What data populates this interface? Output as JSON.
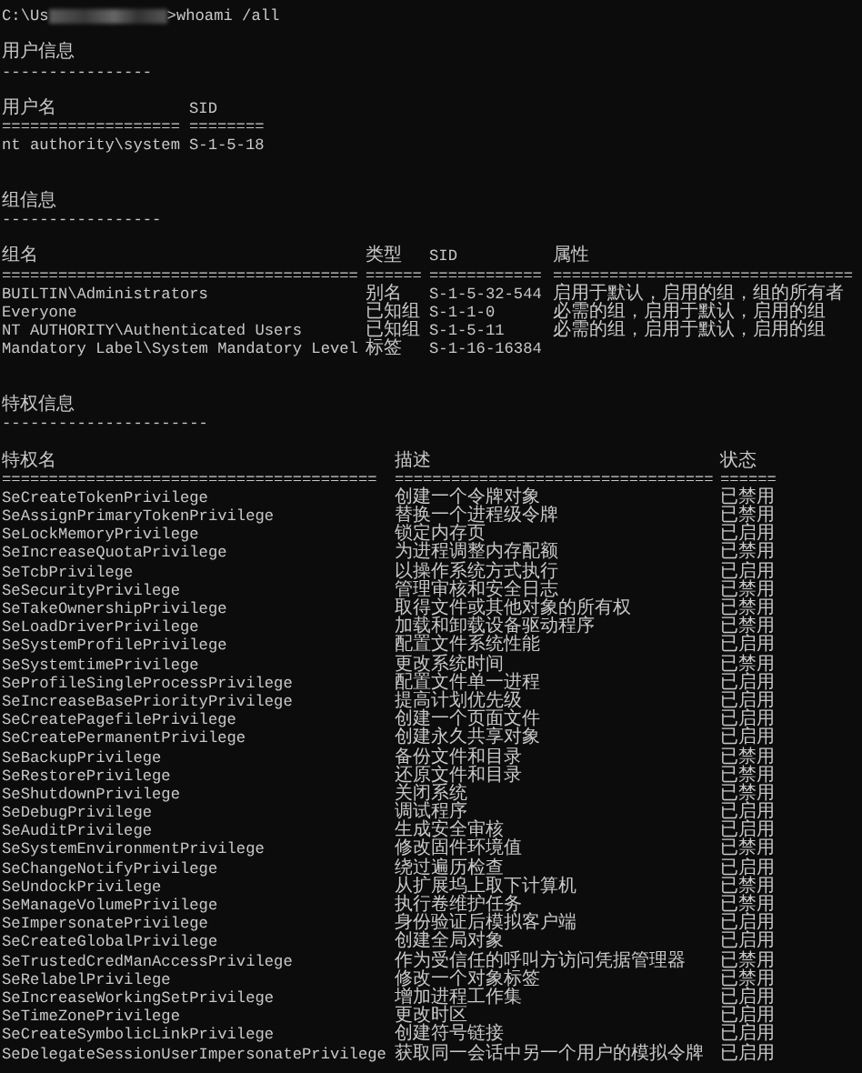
{
  "prompt": {
    "path_start": "C:\\Us",
    "command": ">whoami /all"
  },
  "user_info": {
    "heading": "用户信息",
    "underline": "----------------",
    "columns": [
      "用户名",
      "SID"
    ],
    "rules": [
      "===================",
      "========"
    ],
    "rows": [
      {
        "name": "nt authority\\system",
        "sid": "S-1-5-18"
      }
    ]
  },
  "group_info": {
    "heading": "组信息",
    "underline": "-----------------",
    "columns": [
      "组名",
      "类型",
      "SID",
      "属性"
    ],
    "rules": [
      "======================================",
      "======",
      "============",
      "================================"
    ],
    "rows": [
      {
        "name": "BUILTIN\\Administrators",
        "type": "别名",
        "sid": "S-1-5-32-544",
        "attributes": "启用于默认，启用的组，组的所有者"
      },
      {
        "name": "Everyone",
        "type": "已知组",
        "sid": "S-1-1-0",
        "attributes": "必需的组，启用于默认，启用的组"
      },
      {
        "name": "NT AUTHORITY\\Authenticated Users",
        "type": "已知组",
        "sid": "S-1-5-11",
        "attributes": "必需的组，启用于默认，启用的组"
      },
      {
        "name": "Mandatory Label\\System Mandatory Level",
        "type": "标签",
        "sid": "S-1-16-16384"
      }
    ]
  },
  "privileges": {
    "heading": "特权信息",
    "underline": "----------------------",
    "columns": [
      "特权名",
      "描述",
      "状态"
    ],
    "rules": [
      "========================================",
      "==================================",
      "======"
    ],
    "rows": [
      {
        "name": "SeCreateTokenPrivilege",
        "description": "创建一个令牌对象",
        "state": "已禁用"
      },
      {
        "name": "SeAssignPrimaryTokenPrivilege",
        "description": "替换一个进程级令牌",
        "state": "已禁用"
      },
      {
        "name": "SeLockMemoryPrivilege",
        "description": "锁定内存页",
        "state": "已启用"
      },
      {
        "name": "SeIncreaseQuotaPrivilege",
        "description": "为进程调整内存配额",
        "state": "已禁用"
      },
      {
        "name": "SeTcbPrivilege",
        "description": "以操作系统方式执行",
        "state": "已启用"
      },
      {
        "name": "SeSecurityPrivilege",
        "description": "管理审核和安全日志",
        "state": "已禁用"
      },
      {
        "name": "SeTakeOwnershipPrivilege",
        "description": "取得文件或其他对象的所有权",
        "state": "已禁用"
      },
      {
        "name": "SeLoadDriverPrivilege",
        "description": "加载和卸载设备驱动程序",
        "state": "已禁用"
      },
      {
        "name": "SeSystemProfilePrivilege",
        "description": "配置文件系统性能",
        "state": "已启用"
      },
      {
        "name": "SeSystemtimePrivilege",
        "description": "更改系统时间",
        "state": "已禁用"
      },
      {
        "name": "SeProfileSingleProcessPrivilege",
        "description": "配置文件单一进程",
        "state": "已启用"
      },
      {
        "name": "SeIncreaseBasePriorityPrivilege",
        "description": "提高计划优先级",
        "state": "已启用"
      },
      {
        "name": "SeCreatePagefilePrivilege",
        "description": "创建一个页面文件",
        "state": "已启用"
      },
      {
        "name": "SeCreatePermanentPrivilege",
        "description": "创建永久共享对象",
        "state": "已启用"
      },
      {
        "name": "SeBackupPrivilege",
        "description": "备份文件和目录",
        "state": "已禁用"
      },
      {
        "name": "SeRestorePrivilege",
        "description": "还原文件和目录",
        "state": "已禁用"
      },
      {
        "name": "SeShutdownPrivilege",
        "description": "关闭系统",
        "state": "已禁用"
      },
      {
        "name": "SeDebugPrivilege",
        "description": "调试程序",
        "state": "已启用"
      },
      {
        "name": "SeAuditPrivilege",
        "description": "生成安全审核",
        "state": "已启用"
      },
      {
        "name": "SeSystemEnvironmentPrivilege",
        "description": "修改固件环境值",
        "state": "已禁用"
      },
      {
        "name": "SeChangeNotifyPrivilege",
        "description": "绕过遍历检查",
        "state": "已启用"
      },
      {
        "name": "SeUndockPrivilege",
        "description": "从扩展坞上取下计算机",
        "state": "已禁用"
      },
      {
        "name": "SeManageVolumePrivilege",
        "description": "执行卷维护任务",
        "state": "已禁用"
      },
      {
        "name": "SeImpersonatePrivilege",
        "description": "身份验证后模拟客户端",
        "state": "已启用"
      },
      {
        "name": "SeCreateGlobalPrivilege",
        "description": "创建全局对象",
        "state": "已启用"
      },
      {
        "name": "SeTrustedCredManAccessPrivilege",
        "description": "作为受信任的呼叫方访问凭据管理器",
        "state": "已禁用"
      },
      {
        "name": "SeRelabelPrivilege",
        "description": "修改一个对象标签",
        "state": "已禁用"
      },
      {
        "name": "SeIncreaseWorkingSetPrivilege",
        "description": "增加进程工作集",
        "state": "已启用"
      },
      {
        "name": "SeTimeZonePrivilege",
        "description": "更改时区",
        "state": "已启用"
      },
      {
        "name": "SeCreateSymbolicLinkPrivilege",
        "description": "创建符号链接",
        "state": "已启用"
      },
      {
        "name": "SeDelegateSessionUserImpersonatePrivilege",
        "description": "获取同一会话中另一个用户的模拟令牌",
        "state": "已启用"
      }
    ]
  }
}
